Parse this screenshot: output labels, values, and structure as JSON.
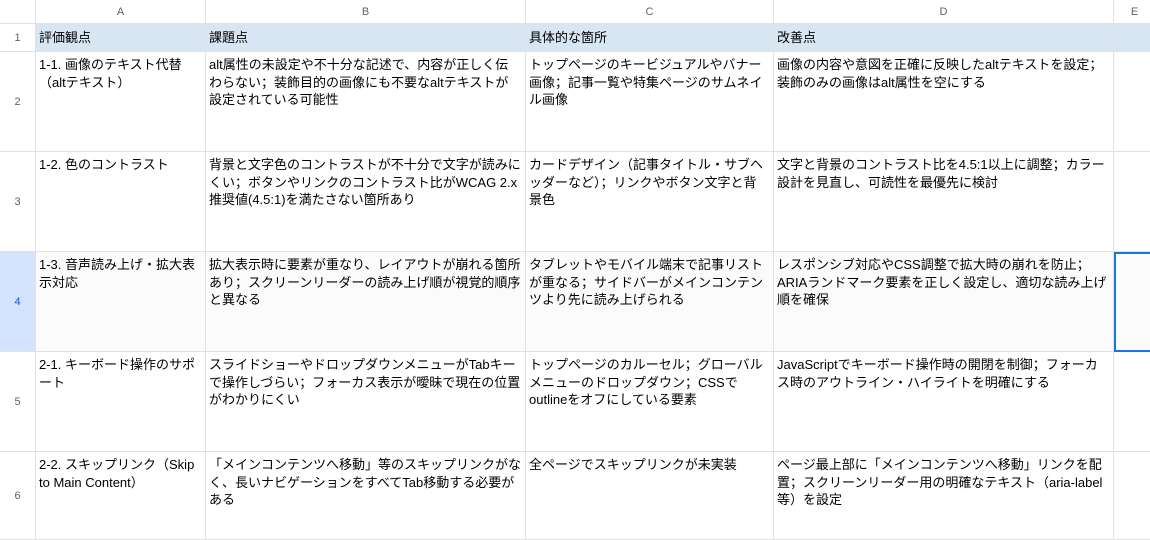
{
  "columns": [
    "A",
    "B",
    "C",
    "D",
    "E"
  ],
  "rowNumbers": [
    "1",
    "2",
    "3",
    "4",
    "5",
    "6"
  ],
  "headers": {
    "A": "評価観点",
    "B": "課題点",
    "C": "具体的な箇所",
    "D": "改善点"
  },
  "rows": [
    {
      "A": "1-1. 画像のテキスト代替（altテキスト）",
      "B": "alt属性の未設定や不十分な記述で、内容が正しく伝わらない；装飾目的の画像にも不要なaltテキストが設定されている可能性",
      "C": "トップページのキービジュアルやバナー画像；記事一覧や特集ページのサムネイル画像",
      "D": "画像の内容や意図を正確に反映したaltテキストを設定；装飾のみの画像はalt属性を空にする"
    },
    {
      "A": "1-2. 色のコントラスト",
      "B": "背景と文字色のコントラストが不十分で文字が読みにくい；ボタンやリンクのコントラスト比がWCAG 2.x推奨値(4.5:1)を満たさない箇所あり",
      "C": "カードデザイン（記事タイトル・サブヘッダーなど）；リンクやボタン文字と背景色",
      "D": "文字と背景のコントラスト比を4.5:1以上に調整；カラー設計を見直し、可読性を最優先に検討"
    },
    {
      "A": "1-3. 音声読み上げ・拡大表示対応",
      "B": "拡大表示時に要素が重なり、レイアウトが崩れる箇所あり；スクリーンリーダーの読み上げ順が視覚的順序と異なる",
      "C": "タブレットやモバイル端末で記事リストが重なる；サイドバーがメインコンテンツより先に読み上げられる",
      "D": "レスポンシブ対応やCSS調整で拡大時の崩れを防止；ARIAランドマーク要素を正しく設定し、適切な読み上げ順を確保"
    },
    {
      "A": "2-1. キーボード操作のサポート",
      "B": "スライドショーやドロップダウンメニューがTabキーで操作しづらい；フォーカス表示が曖昧で現在の位置がわかりにくい",
      "C": "トップページのカルーセル；グローバルメニューのドロップダウン；CSSでoutlineをオフにしている要素",
      "D": "JavaScriptでキーボード操作時の開閉を制御；フォーカス時のアウトライン・ハイライトを明確にする"
    },
    {
      "A": "2-2. スキップリンク（Skip to Main Content）",
      "B": "「メインコンテンツへ移動」等のスキップリンクがなく、長いナビゲーションをすべてTab移動する必要がある",
      "C": "全ページでスキップリンクが未実装",
      "D": "ページ最上部に「メインコンテンツへ移動」リンクを配置；スクリーンリーダー用の明確なテキスト（aria-label等）を設定"
    }
  ],
  "selectedRow": 4,
  "activeCell": "E4"
}
